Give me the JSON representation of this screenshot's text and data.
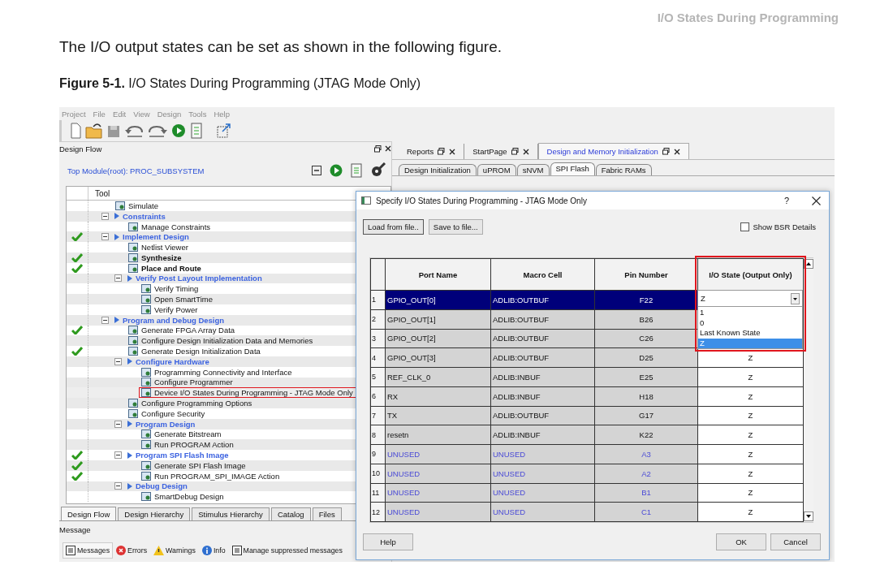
{
  "page_header": "I/O States During Programming",
  "paragraph": "The I/O output states can be set as shown in the following figure.",
  "caption": "**Figure 5-1.** I/O States During Programming (JTAG Mode Only)",
  "app": {
    "menu": [
      {
        "label": "Project",
        "disabled": true
      },
      {
        "label": "File",
        "disabled": true
      },
      {
        "label": "Edit",
        "disabled": true
      },
      {
        "label": "View",
        "disabled": true
      },
      {
        "label": "Design",
        "disabled": true
      },
      {
        "label": "Tools",
        "disabled": true
      },
      {
        "label": "Help",
        "disabled": true
      }
    ],
    "flow_panel": {
      "title": "Design Flow",
      "top_module": "Top Module(root): PROC_SUBSYSTEM",
      "column_header": "Tool",
      "tree": [
        {
          "kind": "tool",
          "label": "Simulate",
          "done": false,
          "bold": false,
          "marked": false
        },
        {
          "kind": "group",
          "label": "Constraints",
          "done": false,
          "expanded": true,
          "children": [
            {
              "kind": "tool",
              "label": "Manage Constraints",
              "done": false,
              "bold": false,
              "marked": false
            }
          ]
        },
        {
          "kind": "group",
          "label": "Implement Design",
          "done": true,
          "expanded": true,
          "children": [
            {
              "kind": "tool",
              "label": "Netlist Viewer",
              "done": false,
              "bold": false,
              "marked": false
            },
            {
              "kind": "tool",
              "label": "Synthesize",
              "done": true,
              "bold": true,
              "marked": false
            },
            {
              "kind": "tool",
              "label": "Place and Route",
              "done": true,
              "bold": true,
              "marked": false
            },
            {
              "kind": "group",
              "label": "Verify Post Layout Implementation",
              "done": false,
              "expanded": true,
              "children": [
                {
                  "kind": "tool",
                  "label": "Verify Timing",
                  "done": false,
                  "bold": false,
                  "marked": false
                },
                {
                  "kind": "tool",
                  "label": "Open SmartTime",
                  "done": false,
                  "bold": false,
                  "marked": false
                },
                {
                  "kind": "tool",
                  "label": "Verify Power",
                  "done": false,
                  "bold": false,
                  "marked": false
                }
              ]
            }
          ]
        },
        {
          "kind": "group",
          "label": "Program and Debug Design",
          "done": false,
          "expanded": true,
          "children": [
            {
              "kind": "tool",
              "label": "Generate FPGA Array Data",
              "done": true,
              "bold": false,
              "marked": false
            },
            {
              "kind": "tool",
              "label": "Configure Design Initialization Data and Memories",
              "done": false,
              "bold": false,
              "marked": false
            },
            {
              "kind": "tool",
              "label": "Generate Design Initialization Data",
              "done": true,
              "bold": false,
              "marked": false
            },
            {
              "kind": "group",
              "label": "Configure Hardware",
              "done": false,
              "expanded": true,
              "children": [
                {
                  "kind": "tool",
                  "label": "Programming Connectivity and Interface",
                  "done": false,
                  "bold": false,
                  "marked": false
                },
                {
                  "kind": "tool",
                  "label": "Configure Programmer",
                  "done": false,
                  "bold": false,
                  "marked": false
                },
                {
                  "kind": "tool",
                  "label": "Device I/O States During Programming - JTAG Mode Only",
                  "done": false,
                  "bold": false,
                  "marked": true
                }
              ]
            },
            {
              "kind": "tool",
              "label": "Configure Programming Options",
              "done": false,
              "bold": false,
              "marked": false
            },
            {
              "kind": "tool",
              "label": "Configure Security",
              "done": false,
              "bold": false,
              "marked": false
            },
            {
              "kind": "group",
              "label": "Program Design",
              "done": false,
              "expanded": true,
              "children": [
                {
                  "kind": "tool",
                  "label": "Generate Bitstream",
                  "done": false,
                  "bold": false,
                  "marked": false
                },
                {
                  "kind": "tool",
                  "label": "Run PROGRAM Action",
                  "done": false,
                  "bold": false,
                  "marked": false
                }
              ]
            },
            {
              "kind": "group",
              "label": "Program SPI Flash Image",
              "done": true,
              "expanded": true,
              "children": [
                {
                  "kind": "tool",
                  "label": "Generate SPI Flash Image",
                  "done": true,
                  "bold": false,
                  "marked": false
                },
                {
                  "kind": "tool",
                  "label": "Run PROGRAM_SPI_IMAGE Action",
                  "done": true,
                  "bold": false,
                  "marked": false
                }
              ]
            },
            {
              "kind": "group",
              "label": "Debug Design",
              "done": false,
              "expanded": true,
              "children": [
                {
                  "kind": "tool",
                  "label": "SmartDebug Design",
                  "done": false,
                  "bold": false,
                  "marked": false
                }
              ]
            }
          ]
        }
      ]
    },
    "bottom_tabs": [
      {
        "label": "Design Flow",
        "selected": true
      },
      {
        "label": "Design Hierarchy",
        "selected": false
      },
      {
        "label": "Stimulus Hierarchy",
        "selected": false
      },
      {
        "label": "Catalog",
        "selected": false
      },
      {
        "label": "Files",
        "selected": false
      }
    ],
    "message_panel": {
      "title": "Message",
      "buttons": [
        {
          "kind": "list",
          "label": "Messages"
        },
        {
          "kind": "error",
          "label": "Errors"
        },
        {
          "kind": "warning",
          "label": "Warnings"
        },
        {
          "kind": "info",
          "label": "Info"
        },
        {
          "kind": "list",
          "label": "Manage suppressed messages"
        }
      ]
    },
    "doc_tabs": [
      {
        "label": "Reports",
        "selected": false
      },
      {
        "label": "StartPage",
        "selected": false
      },
      {
        "label": "Design and Memory Initialization",
        "selected": true
      }
    ],
    "sub_tabs": [
      {
        "label": "Design Initialization",
        "selected": false
      },
      {
        "label": "uPROM",
        "selected": false
      },
      {
        "label": "sNVM",
        "selected": false
      },
      {
        "label": "SPI Flash",
        "selected": true
      },
      {
        "label": "Fabric RAMs",
        "selected": false
      }
    ]
  },
  "dialog": {
    "title": "Specify I/O States During Programming - JTAG Mode Only",
    "help_glyph": "?",
    "top_buttons": [
      "Load from file..",
      "Save to file..."
    ],
    "show_bsr": {
      "label": "Show BSR Details",
      "checked": false
    },
    "table": {
      "columns": [
        "Port Name",
        "Macro Cell",
        "Pin Number",
        "I/O State (Output Only)"
      ],
      "rows": [
        {
          "number": "1",
          "port": "GPIO_OUT[0]",
          "cell": "ADLIB:OUTBUF",
          "pin": "F22",
          "selected": true,
          "unused": false
        },
        {
          "number": "2",
          "port": "GPIO_OUT[1]",
          "cell": "ADLIB:OUTBUF",
          "pin": "B26",
          "selected": false,
          "unused": false
        },
        {
          "number": "3",
          "port": "GPIO_OUT[2]",
          "cell": "ADLIB:OUTBUF",
          "pin": "C26",
          "selected": false,
          "unused": false
        },
        {
          "number": "4",
          "port": "GPIO_OUT[3]",
          "cell": "ADLIB:OUTBUF",
          "pin": "D25",
          "state": "Z",
          "selected": false,
          "unused": false
        },
        {
          "number": "5",
          "port": "REF_CLK_0",
          "cell": "ADLIB:INBUF",
          "pin": "E25",
          "state": "Z",
          "selected": false,
          "unused": false
        },
        {
          "number": "6",
          "port": "RX",
          "cell": "ADLIB:INBUF",
          "pin": "H18",
          "state": "Z",
          "selected": false,
          "unused": false
        },
        {
          "number": "7",
          "port": "TX",
          "cell": "ADLIB:OUTBUF",
          "pin": "G17",
          "state": "Z",
          "selected": false,
          "unused": false
        },
        {
          "number": "8",
          "port": "resetn",
          "cell": "ADLIB:INBUF",
          "pin": "K22",
          "state": "Z",
          "selected": false,
          "unused": false
        },
        {
          "number": "9",
          "port": "UNUSED",
          "cell": "UNUSED",
          "pin": "A3",
          "state": "Z",
          "selected": false,
          "unused": true
        },
        {
          "number": "10",
          "port": "UNUSED",
          "cell": "UNUSED",
          "pin": "A2",
          "state": "Z",
          "selected": false,
          "unused": true
        },
        {
          "number": "11",
          "port": "UNUSED",
          "cell": "UNUSED",
          "pin": "B1",
          "state": "Z",
          "selected": false,
          "unused": true
        },
        {
          "number": "12",
          "port": "UNUSED",
          "cell": "UNUSED",
          "pin": "C1",
          "state": "Z",
          "selected": false,
          "unused": true
        }
      ]
    },
    "state_dropdown": {
      "value": "Z",
      "highlighted": true,
      "options": [
        {
          "label": "1",
          "selected": false
        },
        {
          "label": "0",
          "selected": false
        },
        {
          "label": "Last Known State",
          "selected": false
        },
        {
          "label": "Z",
          "selected": true
        }
      ]
    },
    "bottom_buttons": [
      {
        "kind": "help",
        "label": "Help"
      },
      {
        "kind": "ok",
        "label": "OK"
      },
      {
        "kind": "cancel",
        "label": "Cancel"
      }
    ]
  }
}
